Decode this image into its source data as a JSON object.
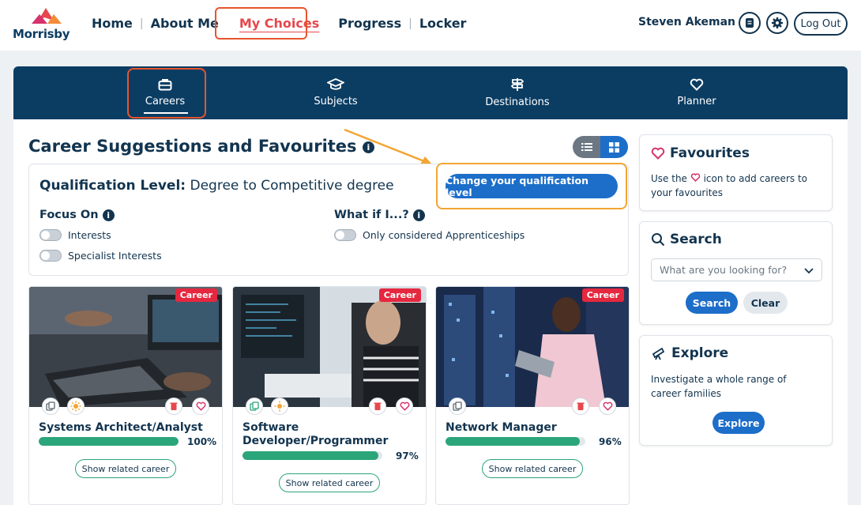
{
  "header": {
    "logo_text": "Morrisby",
    "nav": [
      "Home",
      "About Me",
      "My Choices",
      "Progress",
      "Locker"
    ],
    "active_nav": "My Choices",
    "user_name": "Steven Akeman",
    "logout_label": "Log Out"
  },
  "tabs": [
    {
      "label": "Careers",
      "icon": "briefcase-icon"
    },
    {
      "label": "Subjects",
      "icon": "graduation-cap-icon"
    },
    {
      "label": "Destinations",
      "icon": "signpost-icon"
    },
    {
      "label": "Planner",
      "icon": "heart-icon"
    }
  ],
  "main": {
    "title": "Career Suggestions and Favourites",
    "qualification_label": "Qualification Level:",
    "qualification_value": "Degree to Competitive degree",
    "change_button": "Change your qualification level",
    "focus_on": {
      "heading": "Focus On",
      "options": [
        "Interests",
        "Specialist Interests"
      ]
    },
    "what_if": {
      "heading": "What if I...?",
      "options": [
        "Only considered Apprenticeships"
      ]
    }
  },
  "cards": [
    {
      "tag": "Career",
      "name": "Systems Architect/Analyst",
      "match": "100%",
      "match_value": 100,
      "button": "Show related career"
    },
    {
      "tag": "Career",
      "name": "Software Developer/Programmer",
      "match": "97%",
      "match_value": 97,
      "button": "Show related career"
    },
    {
      "tag": "Career",
      "name": "Network Manager",
      "match": "96%",
      "match_value": 96,
      "button": "Show related career"
    }
  ],
  "sidebar": {
    "favourites": {
      "title": "Favourites",
      "text_pre": "Use the",
      "text_post": "icon to add careers to your favourites"
    },
    "search": {
      "title": "Search",
      "placeholder": "What are you looking for?",
      "search_button": "Search",
      "clear_button": "Clear"
    },
    "explore": {
      "title": "Explore",
      "text": "Investigate a whole range of career families",
      "button": "Explore"
    }
  },
  "colors": {
    "brand_navy": "#0b3d63",
    "accent_blue": "#1c6ec9",
    "match_green": "#2ba57a",
    "tag_red": "#e5283f",
    "highlight_orange": "#f2a533",
    "highlight_red": "#e8542c"
  }
}
